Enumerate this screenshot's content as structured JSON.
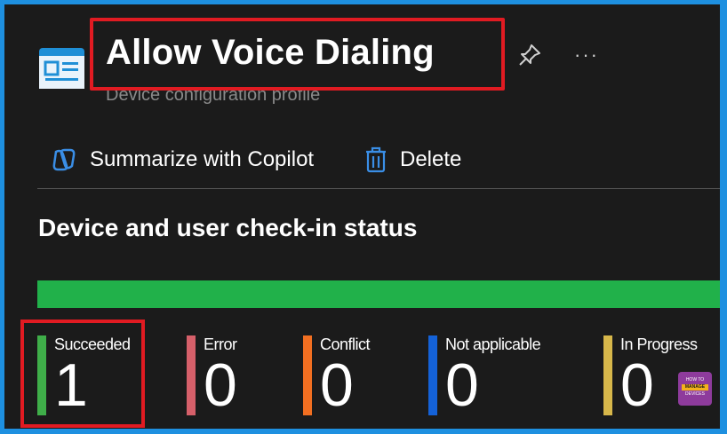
{
  "header": {
    "title": "Allow Voice Dialing",
    "subtitle": "Device configuration profile",
    "icon": "profile-card-icon",
    "pin_icon": "pin-icon",
    "more_label": "···"
  },
  "toolbar": {
    "copilot_label": "Summarize with Copilot",
    "copilot_icon": "copilot-icon",
    "delete_label": "Delete",
    "delete_icon": "trash-icon"
  },
  "section": {
    "title": "Device and user check-in status"
  },
  "progress": {
    "succeeded_fraction": 1.0,
    "color": "#21b14a"
  },
  "stats": [
    {
      "label": "Succeeded",
      "value": "1",
      "color": "#3fae49"
    },
    {
      "label": "Error",
      "value": "0",
      "color": "#d6606a"
    },
    {
      "label": "Conflict",
      "value": "0",
      "color": "#f26f21"
    },
    {
      "label": "Not applicable",
      "value": "0",
      "color": "#1462d8"
    },
    {
      "label": "In Progress",
      "value": "0",
      "color": "#d7b74a"
    }
  ],
  "watermark": {
    "top": "HOW TO",
    "middle": "MANAGE",
    "bottom": "DEVICES"
  },
  "colors": {
    "highlight": "#e11b22",
    "background": "#1b1b1b",
    "border": "#1e90e0"
  }
}
